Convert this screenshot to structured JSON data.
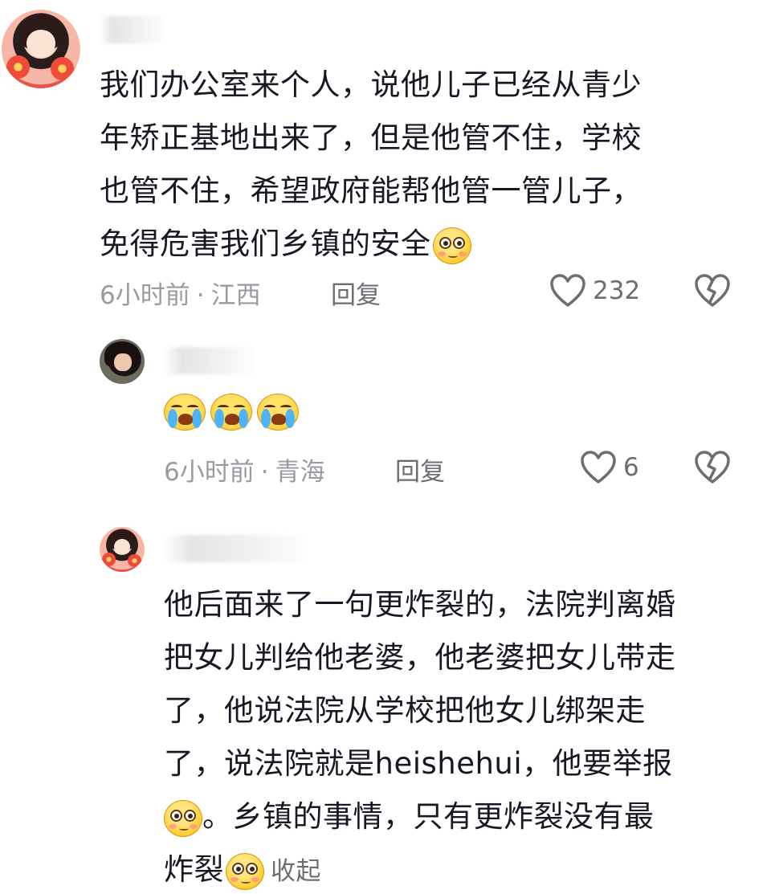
{
  "comments": [
    {
      "text_lines": [
        "我们办公室来个人，说他儿子已经从青少",
        "年矫正基地出来了，但是他管不住，学校",
        "也管不住，希望政府能帮他管一管儿子，",
        "免得危害我们乡镇的安全"
      ],
      "time": "6小时前",
      "location": "江西",
      "reply_label": "回复",
      "likes": "232"
    },
    {
      "time": "6小时前",
      "location": "青海",
      "reply_label": "回复",
      "likes": "6"
    },
    {
      "text_lines": [
        "他后面来了一句更炸裂的，法院判离婚",
        "把女儿判给他老婆，他老婆把女儿带走",
        "了，他说法院从学校把他女儿绑架走",
        "了，说法院就是heishehui，他要举报"
      ],
      "line5": "。乡镇的事情，只有更炸裂没有最",
      "line6": "炸裂",
      "collapse_label": "收起"
    }
  ],
  "separator": "·",
  "colors": {
    "text": "#161823",
    "meta": "#9a9ba0",
    "action": "#6d6e74",
    "emoji": "#ffcc2e"
  }
}
